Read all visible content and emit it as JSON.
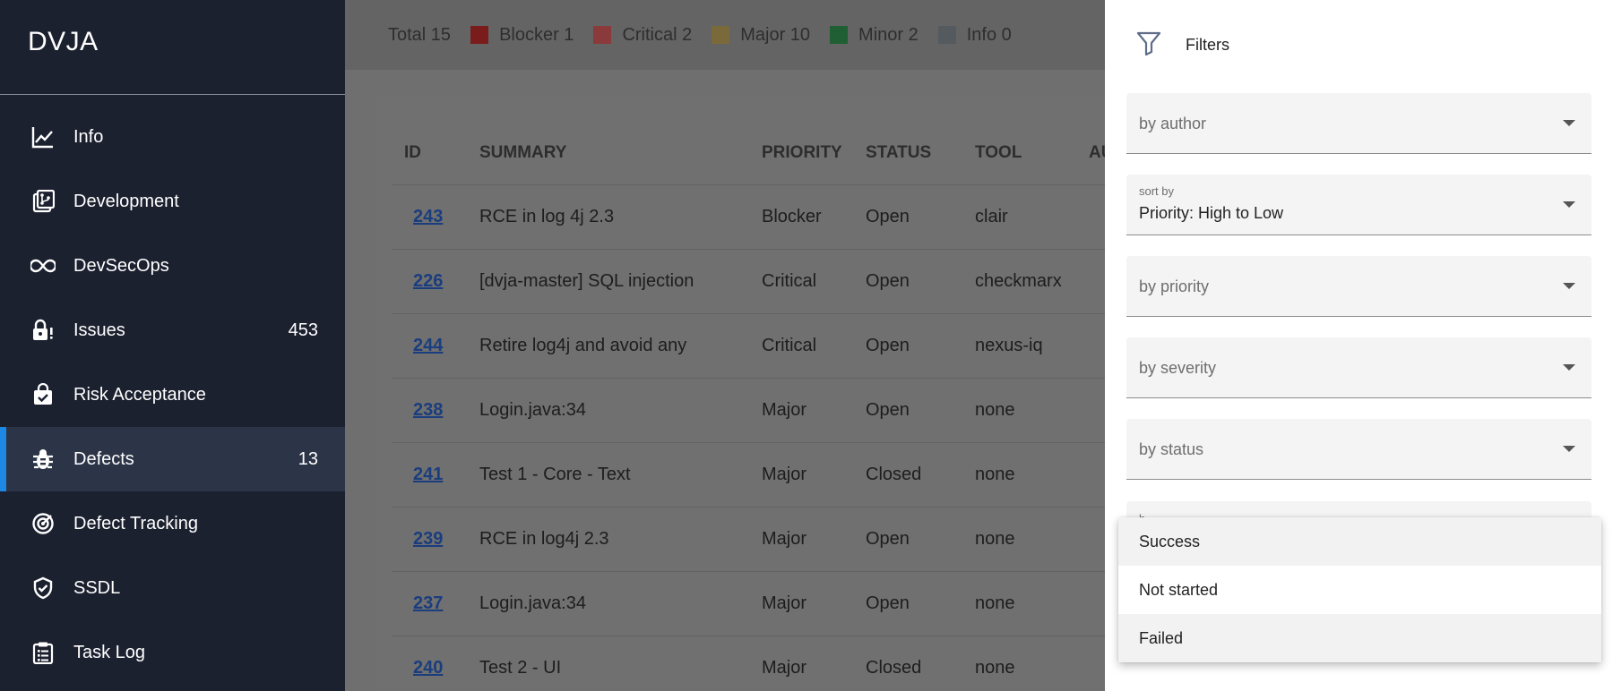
{
  "app": {
    "brand": "DVJA"
  },
  "sidebar": {
    "items": [
      {
        "label": "Info",
        "icon": "chart-line-icon",
        "count": ""
      },
      {
        "label": "Development",
        "icon": "source-branch-icon",
        "count": ""
      },
      {
        "label": "DevSecOps",
        "icon": "infinity-icon",
        "count": ""
      },
      {
        "label": "Issues",
        "icon": "lock-alert-icon",
        "count": "453"
      },
      {
        "label": "Risk Acceptance",
        "icon": "shield-check-bag-icon",
        "count": ""
      },
      {
        "label": "Defects",
        "icon": "bug-icon",
        "count": "13",
        "active": true
      },
      {
        "label": "Defect Tracking",
        "icon": "radar-icon",
        "count": ""
      },
      {
        "label": "SSDL",
        "icon": "shield-check-icon",
        "count": ""
      },
      {
        "label": "Task Log",
        "icon": "clipboard-list-icon",
        "count": ""
      }
    ]
  },
  "legend": {
    "total": "Total 15",
    "items": [
      {
        "label": "Blocker 1",
        "color": "#7a1c1c"
      },
      {
        "label": "Critical 2",
        "color": "#8a3a3a"
      },
      {
        "label": "Major 10",
        "color": "#7a6a3a"
      },
      {
        "label": "Minor 2",
        "color": "#1f5f33"
      },
      {
        "label": "Info 0",
        "color": "#545a5d"
      }
    ]
  },
  "table": {
    "headers": [
      "ID",
      "SUMMARY",
      "PRIORITY",
      "STATUS",
      "TOOL",
      "AU"
    ],
    "rows": [
      [
        "243",
        "RCE in log 4j 2.3",
        "Blocker",
        "Open",
        "clair"
      ],
      [
        "226",
        "[dvja-master] SQL injection",
        "Critical",
        "Open",
        "checkmarx"
      ],
      [
        "244",
        "Retire log4j and avoid any",
        "Critical",
        "Open",
        "nexus-iq"
      ],
      [
        "238",
        "Login.java:34",
        "Major",
        "Open",
        "none"
      ],
      [
        "241",
        "Test 1 - Core - Text",
        "Major",
        "Closed",
        "none"
      ],
      [
        "239",
        "RCE in log4j 2.3",
        "Major",
        "Open",
        "none"
      ],
      [
        "237",
        "Login.java:34",
        "Major",
        "Open",
        "none"
      ],
      [
        "240",
        "Test 2 - UI",
        "Major",
        "Closed",
        "none"
      ]
    ]
  },
  "filters": {
    "title": "Filters",
    "by_author": "by author",
    "sort_label": "sort by",
    "sort_value": "Priority: High to Low",
    "by_priority": "by priority",
    "by_severity": "by severity",
    "by_status": "by status",
    "partial_label": "b"
  },
  "dropdown": {
    "options": [
      "Success",
      "Not started",
      "Failed"
    ]
  }
}
